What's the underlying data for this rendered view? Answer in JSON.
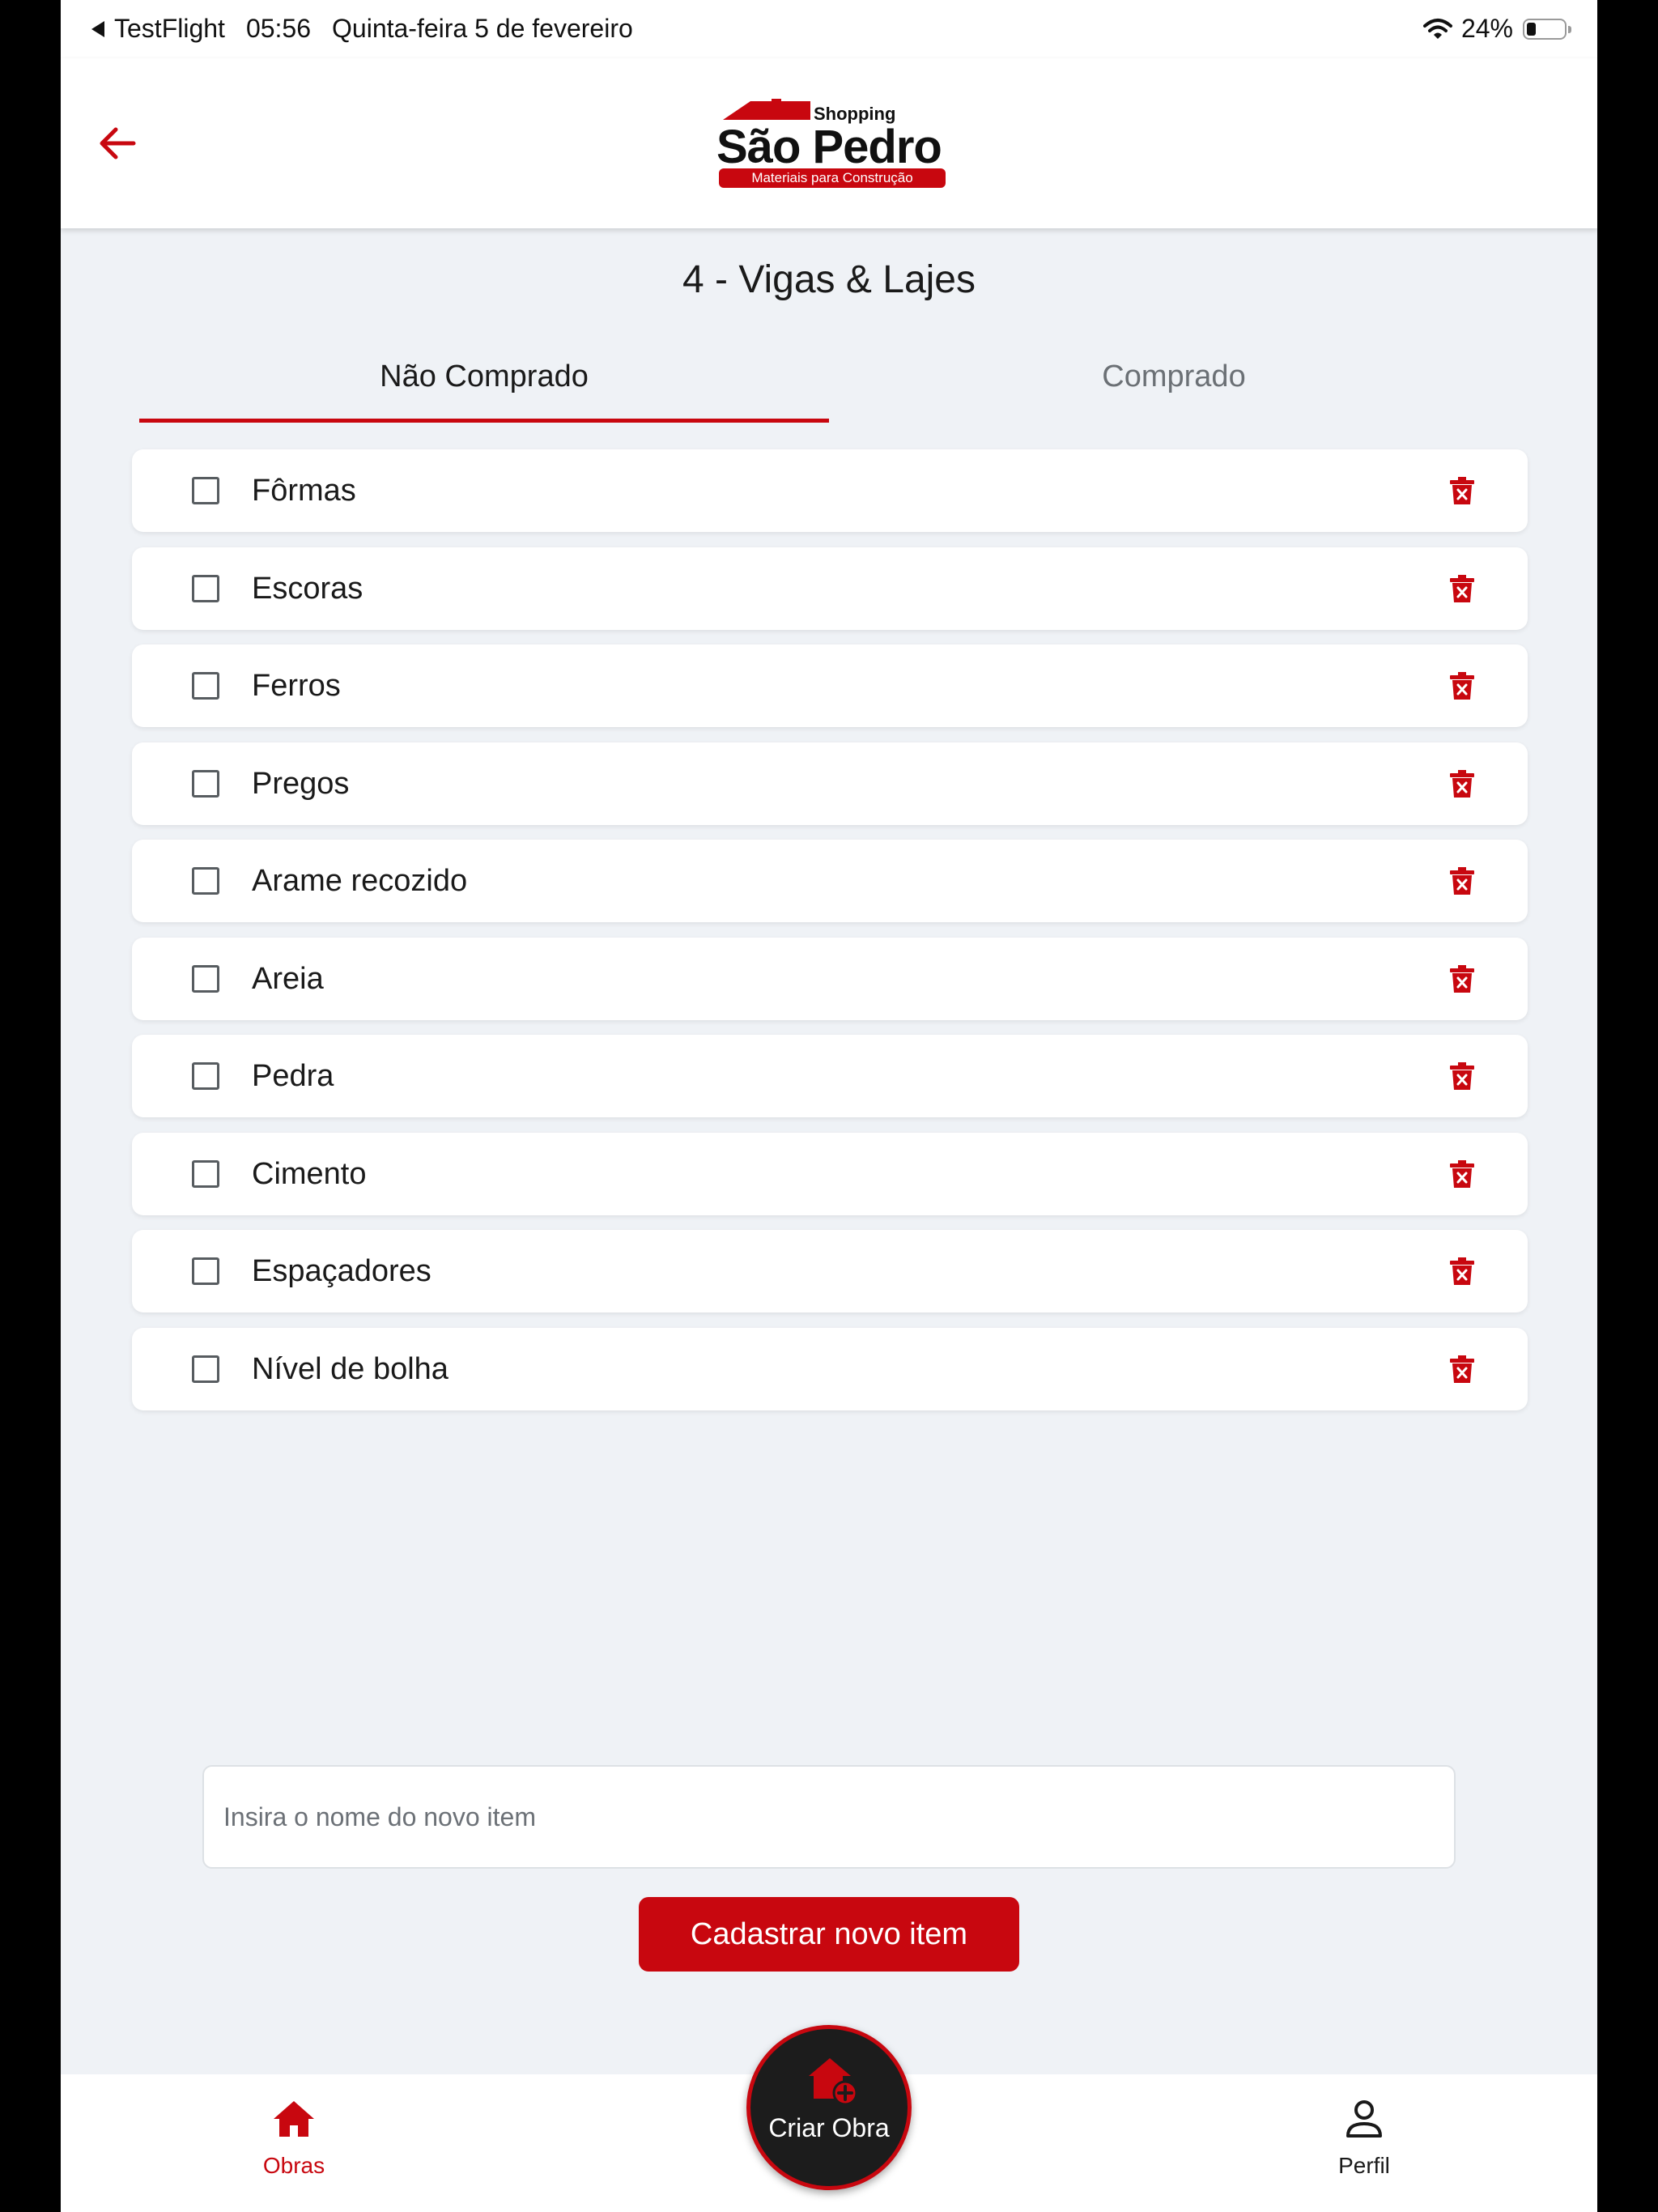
{
  "status_bar": {
    "back_app": "TestFlight",
    "time": "05:56",
    "date": "Quinta-feira 5 de fevereiro",
    "battery": "24%",
    "battery_level": 0.24
  },
  "header": {
    "logo": {
      "shopping": "Shopping",
      "brand": "São Pedro",
      "tagline": "Materiais para Construção"
    }
  },
  "page": {
    "title": "4 - Vigas & Lajes"
  },
  "tabs": [
    {
      "label": "Não Comprado",
      "active": true
    },
    {
      "label": "Comprado",
      "active": false
    }
  ],
  "items": [
    {
      "label": "Fôrmas",
      "checked": false
    },
    {
      "label": "Escoras",
      "checked": false
    },
    {
      "label": "Ferros",
      "checked": false
    },
    {
      "label": "Pregos",
      "checked": false
    },
    {
      "label": "Arame recozido",
      "checked": false
    },
    {
      "label": "Areia",
      "checked": false
    },
    {
      "label": "Pedra",
      "checked": false
    },
    {
      "label": "Cimento",
      "checked": false
    },
    {
      "label": "Espaçadores",
      "checked": false
    },
    {
      "label": "Nível de bolha",
      "checked": false
    }
  ],
  "new_item": {
    "placeholder": "Insira o nome do novo item",
    "value": "",
    "button_label": "Cadastrar novo item"
  },
  "bottom_nav": {
    "obras": {
      "label": "Obras",
      "icon": "home-icon",
      "active": true
    },
    "fab": {
      "label": "Criar Obra",
      "icon": "add-home-icon"
    },
    "perfil": {
      "label": "Perfil",
      "icon": "user-icon",
      "active": false
    }
  },
  "colors": {
    "accent": "#c8070f",
    "background": "#eff2f6",
    "fab_background": "#1c1c1c"
  }
}
